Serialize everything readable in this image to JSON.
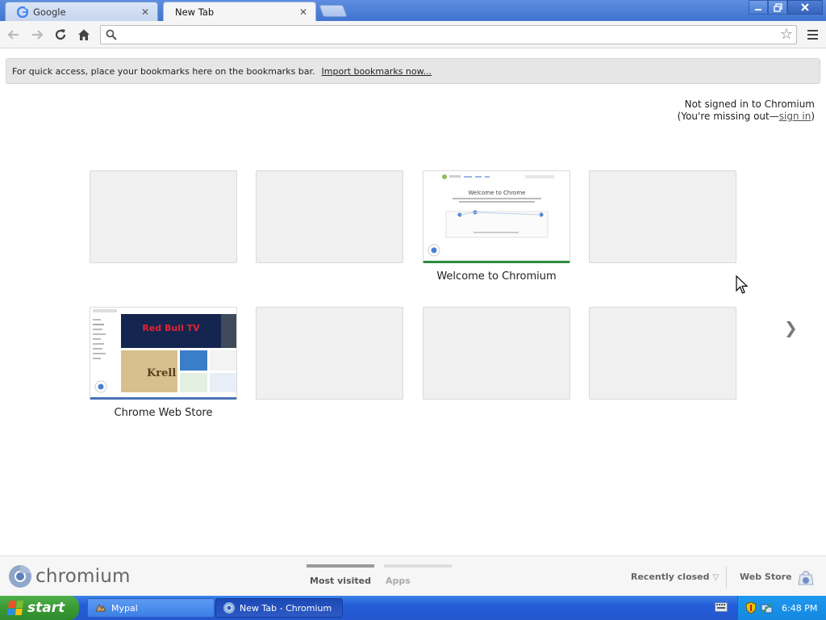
{
  "window": {
    "tabs": [
      {
        "title": "Google",
        "icon": "google-g-icon"
      },
      {
        "title": "New Tab",
        "active": true
      }
    ],
    "close_glyph": "✕"
  },
  "toolbar": {
    "omnibox_value": "",
    "omnibox_placeholder": ""
  },
  "bookmark_bar": {
    "message": "For quick access, place your bookmarks here on the bookmarks bar.",
    "import_link": "Import bookmarks now..."
  },
  "signin": {
    "line1": "Not signed in to Chromium",
    "line2_prefix": "(You're missing out—",
    "link": "sign in",
    "line2_suffix": ")"
  },
  "most_visited": [
    {
      "title": "",
      "thumbnail": "empty"
    },
    {
      "title": "",
      "thumbnail": "empty"
    },
    {
      "title": "Welcome to Chromium",
      "thumbnail": "welcome-page",
      "accent": "#2e8b3e"
    },
    {
      "title": "",
      "thumbnail": "empty"
    },
    {
      "title": "Chrome Web Store",
      "thumbnail": "web-store-page",
      "accent": "#4a73b5"
    },
    {
      "title": "",
      "thumbnail": "empty"
    },
    {
      "title": "",
      "thumbnail": "empty"
    },
    {
      "title": "",
      "thumbnail": "empty"
    }
  ],
  "thumb_welcome": {
    "heading": "Welcome to Chrome"
  },
  "thumb_webstore": {
    "banner": "Red Bull TV"
  },
  "next_page_glyph": "❯",
  "footer": {
    "brand": "chromium",
    "tabs": [
      "Most visited",
      "Apps"
    ],
    "recently_closed": "Recently closed",
    "web_store": "Web Store"
  },
  "taskbar": {
    "start": "start",
    "tasks": [
      {
        "label": "Mypal"
      },
      {
        "label": "New Tab - Chromium"
      }
    ],
    "clock": "6:48 PM"
  },
  "colors": {
    "title_bar": "#3f74cf",
    "taskbar": "#245dd6",
    "start_green": "#3a9a35",
    "tray": "#1488e0"
  }
}
